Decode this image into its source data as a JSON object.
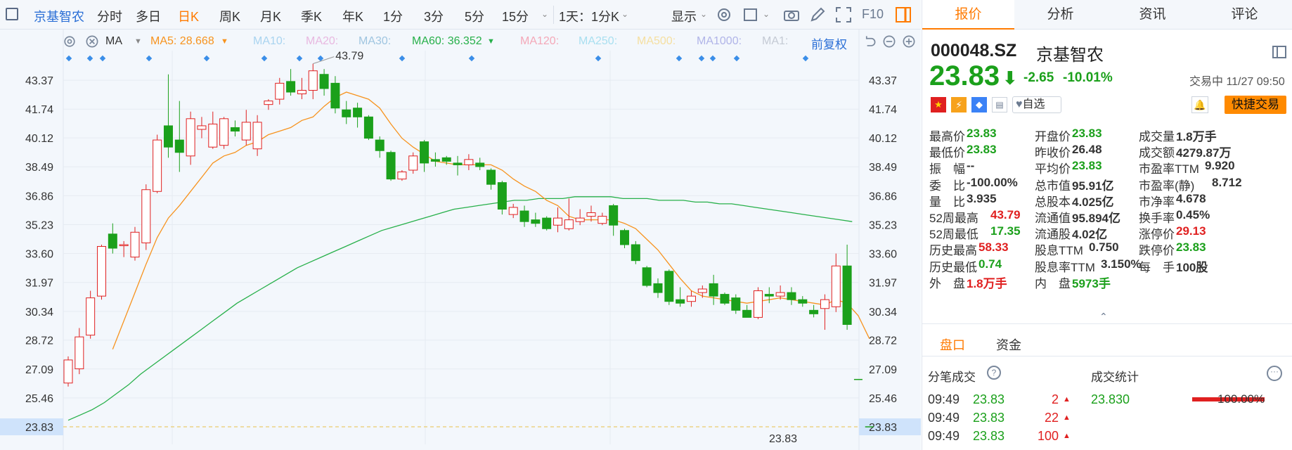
{
  "toolbar": {
    "items": [
      "京基智农",
      "分时",
      "多日",
      "日K",
      "周K",
      "月K",
      "季K",
      "年K",
      "1分",
      "3分",
      "5分",
      "15分",
      "1天：1分K",
      "显示",
      "F10"
    ]
  },
  "ma_bar": {
    "label": "MA",
    "ma5": "MA5: 28.668",
    "ma10": "MA10:",
    "ma20": "MA20:",
    "ma30": "MA30:",
    "ma60": "MA60: 36.352",
    "ma120": "MA120:",
    "ma250": "MA250:",
    "ma500": "MA500:",
    "ma1000": "MA1000:",
    "ma1": "MA1:",
    "adjust": "前复权"
  },
  "chart_data": {
    "type": "candlestick",
    "y_ticks": [
      "43.37",
      "41.74",
      "40.12",
      "38.49",
      "36.86",
      "35.23",
      "33.60",
      "31.97",
      "30.34",
      "28.72",
      "27.09",
      "25.46"
    ],
    "current_price_label": "23.83",
    "high_label": "43.79",
    "low_marker": "23.83",
    "ylim": [
      23.0,
      44.8
    ],
    "candles": [
      [
        26.3,
        27.6,
        26.1,
        27.8
      ],
      [
        27.1,
        28.9,
        26.8,
        29.4
      ],
      [
        29.0,
        31.1,
        28.8,
        31.5
      ],
      [
        31.2,
        34.0,
        31.0,
        34.1
      ],
      [
        34.7,
        33.9,
        33.6,
        35.3
      ],
      [
        34.1,
        34.1,
        33.4,
        34.3
      ],
      [
        33.4,
        34.8,
        33.2,
        35.1
      ],
      [
        34.2,
        37.2,
        33.8,
        37.5
      ],
      [
        37.1,
        40.0,
        37.0,
        40.3
      ],
      [
        40.8,
        39.6,
        39.0,
        43.7
      ],
      [
        40.0,
        39.3,
        38.2,
        42.2
      ],
      [
        39.1,
        41.2,
        38.6,
        41.6
      ],
      [
        40.6,
        40.8,
        40.1,
        41.3
      ],
      [
        39.6,
        40.9,
        39.5,
        41.6
      ],
      [
        39.7,
        41.2,
        39.5,
        41.3
      ],
      [
        40.7,
        40.5,
        40.2,
        41.1
      ],
      [
        40.0,
        41.0,
        39.7,
        41.7
      ],
      [
        39.5,
        41.0,
        39.1,
        41.4
      ],
      [
        42.0,
        42.2,
        41.7,
        42.3
      ],
      [
        42.3,
        43.2,
        42.0,
        43.5
      ],
      [
        43.3,
        42.7,
        42.5,
        44.0
      ],
      [
        42.6,
        42.8,
        42.3,
        43.5
      ],
      [
        42.8,
        43.9,
        42.3,
        44.3
      ],
      [
        43.7,
        42.9,
        42.5,
        44.0
      ],
      [
        43.2,
        41.8,
        41.5,
        43.6
      ],
      [
        41.7,
        41.3,
        40.9,
        42.2
      ],
      [
        41.8,
        41.3,
        40.7,
        42.1
      ],
      [
        41.3,
        40.1,
        40.0,
        41.4
      ],
      [
        40.0,
        39.4,
        39.0,
        40.2
      ],
      [
        39.3,
        37.8,
        37.7,
        39.4
      ],
      [
        37.8,
        38.2,
        37.7,
        38.3
      ],
      [
        38.3,
        39.1,
        38.1,
        39.3
      ],
      [
        39.9,
        38.7,
        38.2,
        40.0
      ],
      [
        38.9,
        38.8,
        38.5,
        39.3
      ],
      [
        39.0,
        38.8,
        38.6,
        39.1
      ],
      [
        38.7,
        38.6,
        38.0,
        39.1
      ],
      [
        38.6,
        38.9,
        38.3,
        39.2
      ],
      [
        38.7,
        38.5,
        38.3,
        39.0
      ],
      [
        38.3,
        37.5,
        37.2,
        38.4
      ],
      [
        37.6,
        36.1,
        35.8,
        37.7
      ],
      [
        35.8,
        36.2,
        35.6,
        36.4
      ],
      [
        36.0,
        35.4,
        35.1,
        36.3
      ],
      [
        35.5,
        35.3,
        35.1,
        35.9
      ],
      [
        35.6,
        35.0,
        34.9,
        35.7
      ],
      [
        35.2,
        35.6,
        34.8,
        36.2
      ],
      [
        35.0,
        35.5,
        34.9,
        36.7
      ],
      [
        35.4,
        35.6,
        35.2,
        36.1
      ],
      [
        35.7,
        35.9,
        35.4,
        36.3
      ],
      [
        35.3,
        35.7,
        35.2,
        35.9
      ],
      [
        36.3,
        35.2,
        34.6,
        36.4
      ],
      [
        34.9,
        34.1,
        33.9,
        35.0
      ],
      [
        34.1,
        33.2,
        33.0,
        34.3
      ],
      [
        32.8,
        31.8,
        31.7,
        32.9
      ],
      [
        31.9,
        31.4,
        31.1,
        32.2
      ],
      [
        32.6,
        30.9,
        30.7,
        32.7
      ],
      [
        31.0,
        30.8,
        30.6,
        31.7
      ],
      [
        30.9,
        31.2,
        30.6,
        31.5
      ],
      [
        31.4,
        31.6,
        31.1,
        31.8
      ],
      [
        31.9,
        31.2,
        30.7,
        32.4
      ],
      [
        31.3,
        30.8,
        30.7,
        31.4
      ],
      [
        31.1,
        30.4,
        30.2,
        31.3
      ],
      [
        30.4,
        30.0,
        30.0,
        30.7
      ],
      [
        30.0,
        31.5,
        29.9,
        31.7
      ],
      [
        31.3,
        31.2,
        30.8,
        31.7
      ],
      [
        31.2,
        31.4,
        31.0,
        31.8
      ],
      [
        31.4,
        31.0,
        30.7,
        31.7
      ],
      [
        31.0,
        30.8,
        30.6,
        31.2
      ],
      [
        30.4,
        30.2,
        30.0,
        30.7
      ],
      [
        30.5,
        31.0,
        29.3,
        31.3
      ],
      [
        30.6,
        32.9,
        30.3,
        33.6
      ],
      [
        32.9,
        29.6,
        29.3,
        34.1
      ],
      [
        26.5,
        26.5,
        26.5,
        26.5
      ],
      [
        23.83,
        23.83,
        23.83,
        23.83
      ]
    ],
    "ma5": [
      null,
      null,
      null,
      null,
      28.2,
      29.8,
      31.4,
      33.0,
      34.5,
      35.6,
      36.3,
      37.1,
      37.9,
      38.7,
      39.1,
      39.3,
      39.7,
      39.9,
      40.3,
      40.5,
      40.7,
      41.1,
      41.3,
      41.9,
      42.4,
      42.7,
      42.5,
      42.3,
      41.8,
      40.9,
      40.1,
      39.6,
      39.2,
      38.8,
      38.7,
      38.6,
      38.6,
      38.6,
      38.6,
      38.3,
      37.8,
      37.4,
      37.1,
      36.6,
      36.3,
      35.7,
      35.5,
      35.5,
      35.5,
      35.5,
      35.3,
      35.0,
      34.4,
      33.8,
      33.0,
      32.2,
      31.5,
      31.2,
      31.1,
      31.0,
      30.9,
      30.8,
      30.9,
      31.0,
      31.1,
      31.0,
      30.9,
      30.8,
      30.7,
      31.0,
      30.8,
      30.1,
      28.8
    ],
    "ma60_start": 7,
    "ma60": [
      24.2,
      24.5,
      24.8,
      25.2,
      25.7,
      26.2,
      26.8,
      27.3,
      27.8,
      28.3,
      28.8,
      29.3,
      29.8,
      30.3,
      30.8,
      31.2,
      31.6,
      32.0,
      32.4,
      32.8,
      33.1,
      33.4,
      33.7,
      34.0,
      34.3,
      34.6,
      34.9,
      35.1,
      35.3,
      35.5,
      35.7,
      35.9,
      36.1,
      36.2,
      36.3,
      36.4,
      36.5,
      36.6,
      36.6,
      36.7,
      36.7,
      36.7,
      36.8,
      36.8,
      36.8,
      36.8,
      36.7,
      36.7,
      36.7,
      36.6,
      36.6,
      36.6,
      36.5,
      36.5,
      36.4,
      36.4,
      36.3,
      36.2,
      36.1,
      36.0,
      35.9,
      35.8,
      35.7,
      35.6,
      35.5,
      35.4
    ]
  },
  "tabs": [
    "报价",
    "分析",
    "资讯",
    "评论"
  ],
  "quote": {
    "code": "000048.SZ",
    "name": "京基智农",
    "price": "23.83",
    "change": "-2.65",
    "pct": "-10.01%",
    "status": "交易中 11/27 09:50",
    "watch": "自选",
    "quick_trade": "快捷交易"
  },
  "stats": {
    "c1": [
      [
        "最高价",
        "23.83",
        "g"
      ],
      [
        "最低价",
        "23.83",
        "g"
      ],
      [
        "振　幅",
        "--",
        "k"
      ],
      [
        "委　比",
        "-100.00%",
        "k"
      ],
      [
        "量　比",
        "3.935",
        "k"
      ],
      [
        "52周最高",
        "43.79",
        "r"
      ],
      [
        "52周最低",
        "17.35",
        "g"
      ],
      [
        "历史最高",
        "58.33",
        "r"
      ],
      [
        "历史最低",
        "0.74",
        "g"
      ],
      [
        "外　盘",
        "1.8万手",
        "r"
      ]
    ],
    "c2": [
      [
        "开盘价",
        "23.83",
        "g"
      ],
      [
        "昨收价",
        "26.48",
        "k"
      ],
      [
        "平均价",
        "23.83",
        "g"
      ],
      [
        "总市值",
        "95.91亿",
        "k"
      ],
      [
        "总股本",
        "4.025亿",
        "k"
      ],
      [
        "流通值",
        "95.894亿",
        "k"
      ],
      [
        "流通股",
        "4.02亿",
        "k"
      ],
      [
        "股息TTM",
        "0.750",
        "k"
      ],
      [
        "股息率TTM",
        "3.150%",
        "k"
      ],
      [
        "内　盘",
        "5973手",
        "g"
      ]
    ],
    "c3": [
      [
        "成交量",
        "1.8万手",
        "k"
      ],
      [
        "成交额",
        "4279.87万",
        "k"
      ],
      [
        "市盈率TTM",
        "9.920",
        "k"
      ],
      [
        "市盈率(静)",
        "8.712",
        "k"
      ],
      [
        "市净率",
        "4.678",
        "k"
      ],
      [
        "换手率",
        "0.45%",
        "k"
      ],
      [
        "涨停价",
        "29.13",
        "r"
      ],
      [
        "跌停价",
        "23.83",
        "g"
      ],
      [
        "每　手",
        "100股",
        "k"
      ]
    ]
  },
  "panel_tabs": [
    "盘口",
    "资金"
  ],
  "trades": {
    "title": "分笔成交",
    "stats_title": "成交统计",
    "stat_price": "23.830",
    "stat_pct": "100.00%",
    "rows": [
      [
        "09:49",
        "23.83",
        "2"
      ],
      [
        "09:49",
        "23.83",
        "22"
      ],
      [
        "09:49",
        "23.83",
        "100"
      ]
    ]
  },
  "colors": {
    "up": "#e02020",
    "down": "#1ba01b",
    "accent": "#ff7a00",
    "ma5": "#f7931e",
    "ma60": "#27b04a"
  }
}
